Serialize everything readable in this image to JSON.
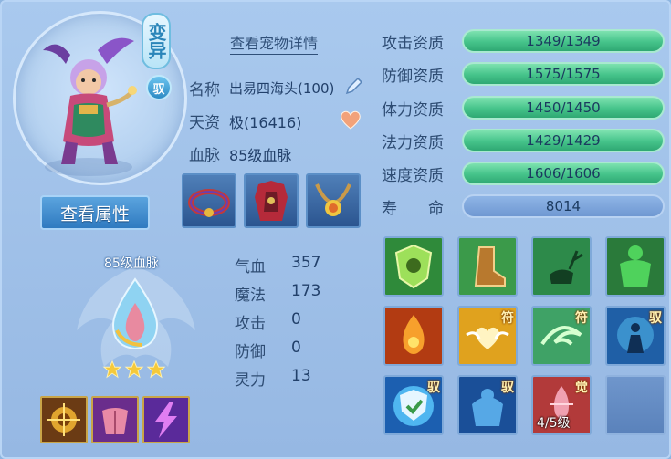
{
  "pet": {
    "variant_tag": "变异",
    "tame_badge": "驭",
    "view_details_link": "查看宠物详情",
    "view_attributes_button": "查看属性",
    "name_label": "名称",
    "name_value": "出易四海头(100)",
    "talent_label": "天资",
    "talent_value": "极(16416)",
    "bloodline_label": "血脉",
    "bloodline_value": "85级血脉"
  },
  "equipment": [
    {
      "name": "collar-equip-icon"
    },
    {
      "name": "armor-equip-icon"
    },
    {
      "name": "necklace-equip-icon"
    }
  ],
  "bloodline_panel": {
    "title": "85级血脉",
    "stars": 3
  },
  "bloodline_stats": [
    {
      "label": "气血",
      "value": "357"
    },
    {
      "label": "魔法",
      "value": "173"
    },
    {
      "label": "攻击",
      "value": "0"
    },
    {
      "label": "防御",
      "value": "0"
    },
    {
      "label": "灵力",
      "value": "13"
    }
  ],
  "bloodline_skills": [
    {
      "icon": "golden-totem-skill-icon"
    },
    {
      "icon": "muscle-body-skill-icon"
    },
    {
      "icon": "lightning-skill-icon"
    }
  ],
  "aptitudes": [
    {
      "label": "攻击资质",
      "value": "1349/1349",
      "fill": 1.0
    },
    {
      "label": "防御资质",
      "value": "1575/1575",
      "fill": 1.0
    },
    {
      "label": "体力资质",
      "value": "1450/1450",
      "fill": 1.0
    },
    {
      "label": "法力资质",
      "value": "1429/1429",
      "fill": 1.0
    },
    {
      "label": "速度资质",
      "value": "1606/1606",
      "fill": 1.0
    }
  ],
  "lifespan": {
    "label": "寿　　命",
    "value": "8014"
  },
  "skills": [
    {
      "icon": "green-shield-skill-icon",
      "badge": ""
    },
    {
      "icon": "boot-skill-icon",
      "badge": ""
    },
    {
      "icon": "deer-skill-icon",
      "badge": ""
    },
    {
      "icon": "green-giant-skill-icon",
      "badge": ""
    },
    {
      "icon": "fire-spirit-skill-icon",
      "badge": ""
    },
    {
      "icon": "heart-wing-skill-icon",
      "badge": "符"
    },
    {
      "icon": "wind-swirl-skill-icon",
      "badge": "符"
    },
    {
      "icon": "meditation-skill-icon",
      "badge": "驭"
    },
    {
      "icon": "blue-shield-skill-icon",
      "badge": "驭"
    },
    {
      "icon": "blue-strength-skill-icon",
      "badge": "驭"
    },
    {
      "icon": "awaken-skill-icon",
      "badge": "觉",
      "level": "4/5级"
    },
    {
      "icon": "empty-skill-slot",
      "badge": ""
    }
  ]
}
